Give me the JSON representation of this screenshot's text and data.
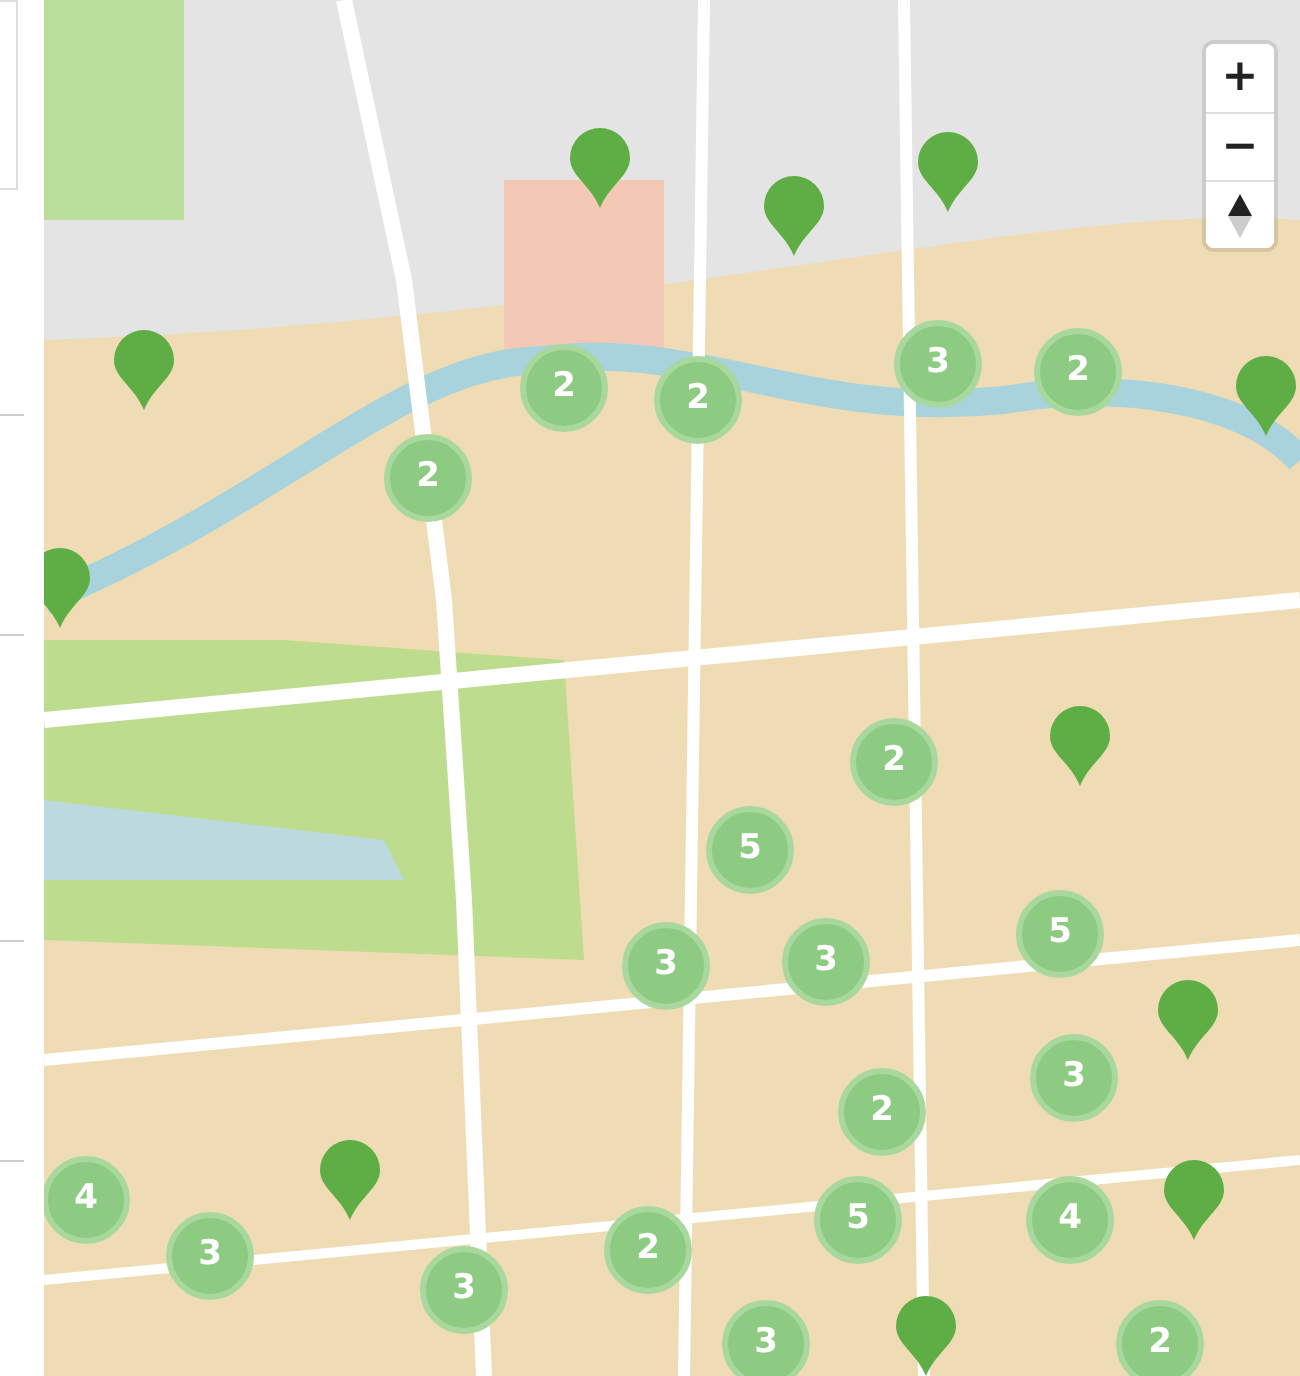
{
  "map": {
    "zoom_controls": [
      {
        "kind": "zoom-in",
        "label": "+"
      },
      {
        "kind": "zoom-out",
        "label": "−"
      },
      {
        "kind": "compass"
      }
    ],
    "clusters": [
      {
        "count": "2"
      },
      {
        "count": "2"
      },
      {
        "count": "3"
      },
      {
        "count": "2"
      },
      {
        "count": "2"
      },
      {
        "count": "2"
      },
      {
        "count": "5"
      },
      {
        "count": "5"
      },
      {
        "count": "3"
      },
      {
        "count": "3"
      },
      {
        "count": "3"
      },
      {
        "count": "2"
      },
      {
        "count": "4"
      },
      {
        "count": "3"
      },
      {
        "count": "2"
      },
      {
        "count": "5"
      },
      {
        "count": "4"
      },
      {
        "count": "3"
      },
      {
        "count": "3"
      },
      {
        "count": "2"
      }
    ]
  }
}
